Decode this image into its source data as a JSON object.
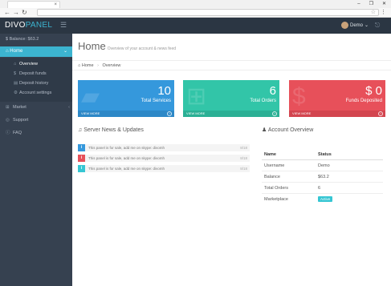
{
  "browser": {
    "tab_close": "×",
    "window_controls": [
      "–",
      "❐",
      "✕"
    ],
    "nav": {
      "back": "←",
      "forward": "→",
      "reload": "↻"
    },
    "menu": "⋮"
  },
  "topbar": {
    "logo_primary": "DIVO",
    "logo_accent": "PANEL",
    "user_name": "Demo"
  },
  "sidebar": {
    "balance": "Balance: $63.2",
    "home": "Home",
    "sub_items": [
      {
        "label": "Overview",
        "icon": "home-icon"
      },
      {
        "label": "Deposit funds",
        "icon": "dollar-icon"
      },
      {
        "label": "Deposit history",
        "icon": "history-icon"
      },
      {
        "label": "Account settings",
        "icon": "gear-icon"
      }
    ],
    "items": [
      {
        "label": "Market",
        "icon": "cart-icon"
      },
      {
        "label": "Support",
        "icon": "headset-icon"
      },
      {
        "label": "FAQ",
        "icon": "help-icon"
      }
    ]
  },
  "page": {
    "title": "Home",
    "subtitle": "Overview of your account & news feed"
  },
  "breadcrumb": {
    "home": "Home",
    "current": "Overview"
  },
  "tiles": [
    {
      "value": "10",
      "label": "Total Services",
      "more": "VIEW MORE",
      "color": "#3598dc"
    },
    {
      "value": "6",
      "label": "Total Orders",
      "more": "VIEW MORE",
      "color": "#32c5a8"
    },
    {
      "value": "$ 0",
      "label": "Funds Deposited",
      "more": "VIEW MORE",
      "color": "#e7505a"
    }
  ],
  "news": {
    "title": "Server News & Updates",
    "items": [
      {
        "text": "This panel is for sale, add me on skype: divomh",
        "time": "8/18",
        "color": "#3598dc"
      },
      {
        "text": "This panel is for sale, add me on skype: divomh",
        "time": "8/18",
        "color": "#e7505a"
      },
      {
        "text": "This panel is for sale, add me on skype: divomh",
        "time": "8/18",
        "color": "#36c6d3"
      }
    ]
  },
  "account": {
    "title": "Account Overview",
    "headers": [
      "Name",
      "Status"
    ],
    "rows": [
      {
        "name": "Username",
        "value": "Demo"
      },
      {
        "name": "Balance",
        "value": "$63.2"
      },
      {
        "name": "Total Orders",
        "value": "6"
      },
      {
        "name": "Marketplace",
        "value": "Active"
      }
    ]
  }
}
